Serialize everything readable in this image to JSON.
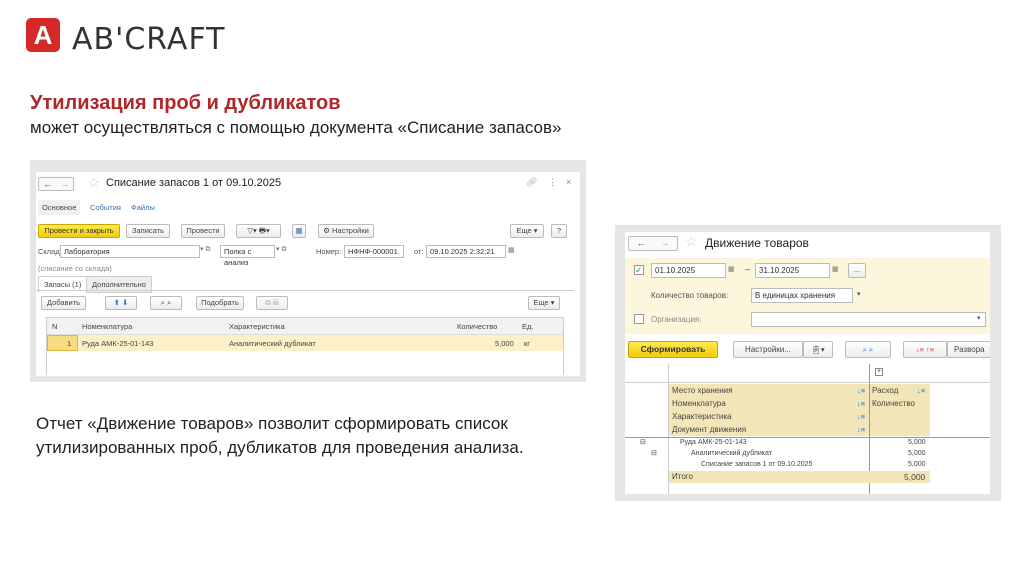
{
  "logo": {
    "mark": "A",
    "text": "AB'CRAFT"
  },
  "heading": "Утилизация проб и дубликатов",
  "subheading": "может осуществляться с помощью документа «Списание запасов»",
  "paragraph": "Отчет «Движение товаров» позволит сформировать список утилизированных проб, дубликатов для проведения анализа.",
  "doc": {
    "title": "Списание запасов 1 от 09.10.2025",
    "tabs": [
      "Основное",
      "События",
      "Файлы"
    ],
    "buttons": {
      "post_close": "Провести и закрыть",
      "save": "Записать",
      "post": "Провести",
      "settings": "Настройки",
      "more": "Еще",
      "help": "?"
    },
    "warehouse_label": "Склад:",
    "warehouse": "Лаборатория",
    "shelf": "Полка с анализ",
    "number_label": "Номер:",
    "number": "НФНФ-000001",
    "date_label": "от:",
    "date": "09.10.2025  2:32:21",
    "note": "(списание со склада)",
    "subtabs": [
      "Запасы (1)",
      "Дополнительно"
    ],
    "table_buttons": {
      "add": "Добавить",
      "pick": "Подобрать",
      "more": "Еще"
    },
    "columns": [
      "N",
      "Номенклатура",
      "Характеристика",
      "Количество",
      "Ед."
    ],
    "rows": [
      {
        "n": "1",
        "item": "Руда  АМК-25-01-143",
        "char": "Аналитический дубликат",
        "qty": "5,000",
        "unit": "кг"
      }
    ]
  },
  "report": {
    "title": "Движение товаров",
    "date_from": "01.10.2025",
    "dash": "–",
    "date_to": "31.10.2025",
    "ellipsis": "...",
    "qty_label": "Количество товаров:",
    "qty_value": "В единицах хранения",
    "org_label": "Организация:",
    "buttons": {
      "generate": "Сформировать",
      "settings": "Настройки...",
      "expand": "Развора"
    },
    "plus": "+",
    "row_headers": [
      "Место хранения",
      "Номенклатура",
      "Характеристика",
      "Документ движения"
    ],
    "col_headers": [
      "Расход",
      "Количество"
    ],
    "rows": [
      {
        "label": "Руда  АМК-25-01-143",
        "value": "5,000"
      },
      {
        "label": "Аналитический дубликат",
        "value": "5,000"
      },
      {
        "label": "Списание запасов 1 от 09.10.2025",
        "value": "5,000"
      }
    ],
    "total_label": "Итого",
    "total_value": "5,000"
  }
}
